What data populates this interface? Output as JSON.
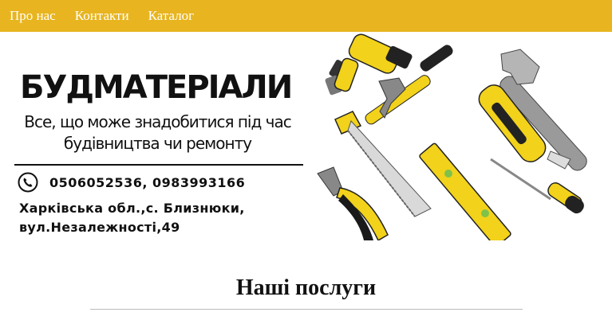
{
  "nav": {
    "items": [
      {
        "label": "Про нас"
      },
      {
        "label": "Контакти"
      },
      {
        "label": "Каталог"
      }
    ]
  },
  "hero": {
    "brand": "БУДМАТЕРІАЛИ",
    "tagline": "Все, що може знадобитися під час будівництва чи ремонту",
    "phone_icon": "phone-icon",
    "phones": "0506052536,  0983993166",
    "address_line1": "Харківська  обл.,с.  Близнюки,",
    "address_line2": "вул.Незалежності,49"
  },
  "services": {
    "title": "Наші послуги"
  },
  "colors": {
    "nav_bg": "#e8b520",
    "tool_yellow": "#f2d21a",
    "tool_black": "#1a1a1a"
  }
}
